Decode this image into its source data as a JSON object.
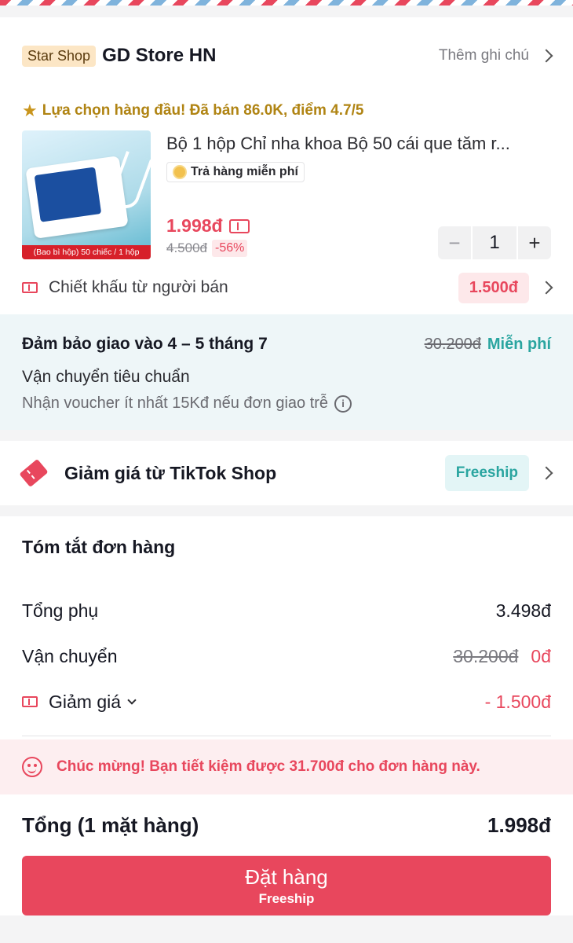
{
  "shop": {
    "badge": "Star Shop",
    "name": "GD Store HN",
    "add_note": "Thêm ghi chú",
    "top_choice": "Lựa chọn hàng đầu! Đã bán 86.0K, điểm 4.7/5"
  },
  "product": {
    "title": "Bộ 1 hộp Chỉ nha khoa Bộ 50 cái que tăm r...",
    "image_caption": "(Bao bì hộp) 50 chiếc / 1 hộp",
    "free_return": "Trả hàng miễn phí",
    "price": "1.998đ",
    "old_price": "4.500đ",
    "discount": "-56%",
    "quantity": "1"
  },
  "seller_discount": {
    "label": "Chiết khấu từ người bán",
    "value": "1.500đ"
  },
  "shipping": {
    "guarantee": "Đảm bảo giao vào 4 – 5 tháng 7",
    "old_fee": "30.200đ",
    "free": "Miễn phí",
    "method": "Vận chuyển tiêu chuẩn",
    "voucher": "Nhận voucher ít nhất 15Kđ nếu đơn giao trễ"
  },
  "tiktok_discount": {
    "label": "Giảm giá từ TikTok Shop",
    "tag": "Freeship"
  },
  "summary": {
    "title": "Tóm tắt đơn hàng",
    "subtotal_label": "Tổng phụ",
    "subtotal": "3.498đ",
    "shipping_label": "Vận chuyển",
    "shipping_old": "30.200đ",
    "shipping_new": "0đ",
    "discount_label": "Giảm giá",
    "discount": "- 1.500đ",
    "congrats": "Chúc mừng! Bạn tiết kiệm được 31.700đ cho đơn hàng này.",
    "total_label": "Tổng (1 mặt hàng)",
    "total": "1.998đ"
  },
  "order_button": {
    "label": "Đặt hàng",
    "sub": "Freeship"
  },
  "colors": {
    "accent": "#e8475d",
    "teal": "#2aa5a0",
    "gold": "#b08413"
  }
}
